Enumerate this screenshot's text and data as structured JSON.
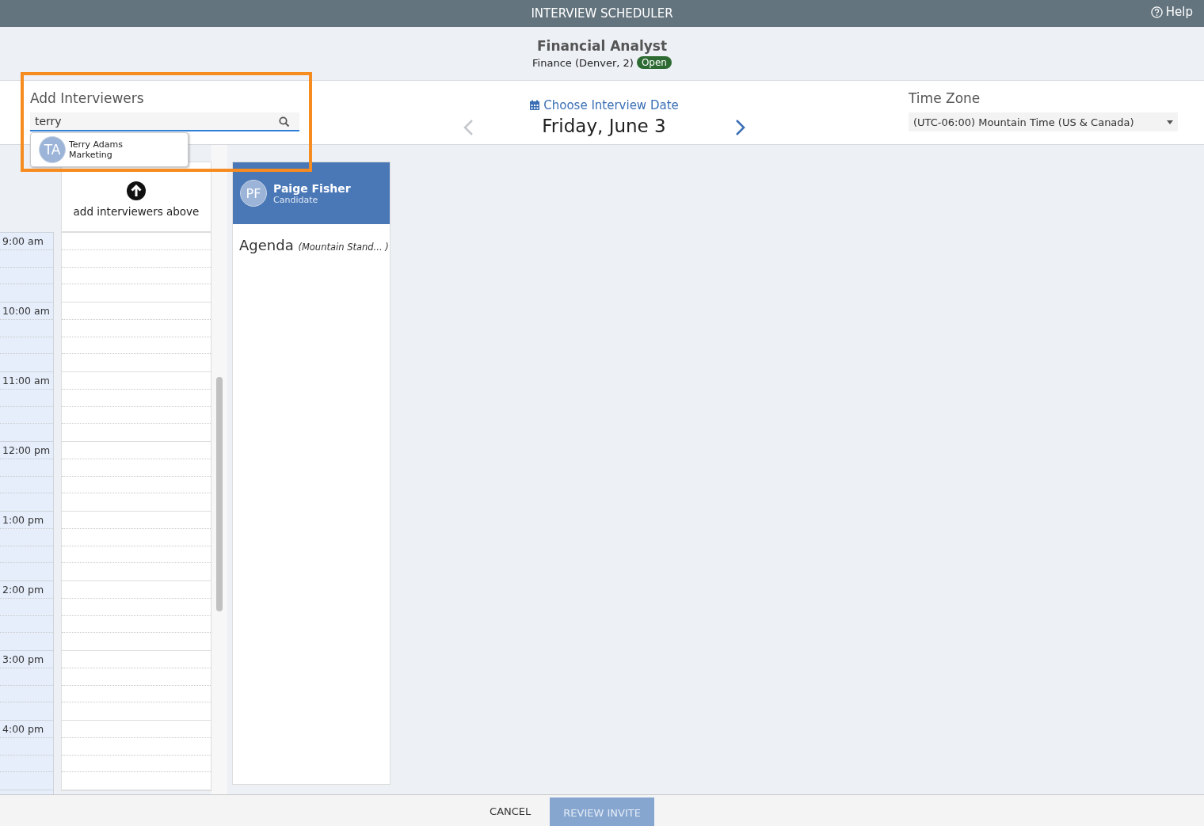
{
  "app_bar": {
    "title": "INTERVIEW SCHEDULER",
    "help": "Help"
  },
  "job": {
    "title": "Financial Analyst",
    "subtitle": "Finance (Denver, 2)",
    "status": "Open"
  },
  "interviewers": {
    "label": "Add Interviewers",
    "value": "terry",
    "suggestions": [
      {
        "initials": "TA",
        "name": "Terry Adams",
        "department": "Marketing"
      }
    ]
  },
  "date_picker": {
    "label": "Choose Interview Date",
    "date": "Friday, June 3",
    "prev_disabled": true,
    "next_disabled": false
  },
  "time_zone": {
    "label": "Time Zone",
    "value": "(UTC-06:00) Mountain Time (US & Canada)"
  },
  "interviewer_column": {
    "hint": "add interviewers above"
  },
  "hours": [
    "9:00 am",
    "10:00 am",
    "11:00 am",
    "12:00 pm",
    "1:00 pm",
    "2:00 pm",
    "3:00 pm",
    "4:00 pm"
  ],
  "candidate": {
    "initials": "PF",
    "name": "Paige Fisher",
    "role": "Candidate",
    "agenda": "Agenda",
    "agenda_zone": "(Mountain Stand... )"
  },
  "footer": {
    "cancel": "CANCEL",
    "review": "REVIEW INVITE",
    "review_disabled": true
  }
}
